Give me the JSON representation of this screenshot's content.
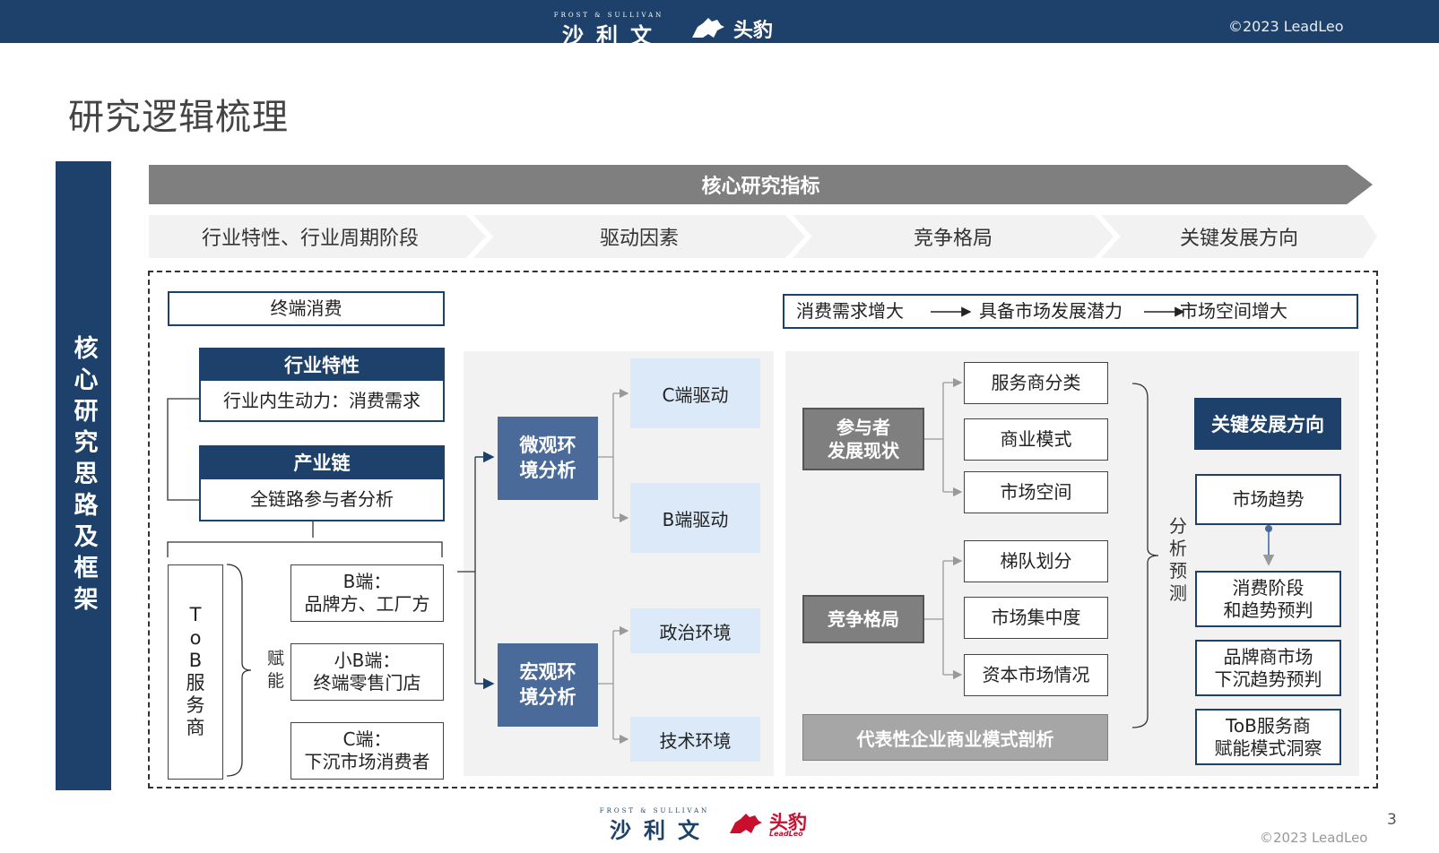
{
  "header": {
    "logo_small": "FROST & SULLIVAN",
    "logo_big": "沙利文",
    "logo_dog": "头豹",
    "logo_dog_sub": "LeadLeo",
    "copyright": "©2023 LeadLeo"
  },
  "title": "研究逻辑梳理",
  "side_label": "核心研究思路及框架",
  "core_indicator": "核心研究指标",
  "chevrons": [
    "行业特性、行业周期阶段",
    "驱动因素",
    "竞争格局",
    "关键发展方向"
  ],
  "col1": {
    "terminal": "终端消费",
    "industry_head": "行业特性",
    "industry_body": "行业内生动力：消费需求",
    "chain_head": "产业链",
    "chain_body": "全链路参与者分析",
    "tob_label": "ToB服务商",
    "empower": "赋能",
    "b_end_1": "B端：",
    "b_end_2": "品牌方、工厂方",
    "smallb_1": "小B端：",
    "smallb_2": "终端零售门店",
    "c_end_1": "C端：",
    "c_end_2": "下沉市场消费者"
  },
  "col2": {
    "micro_1": "微观环",
    "micro_2": "境分析",
    "c_drive": "C端驱动",
    "b_drive": "B端驱动",
    "macro_1": "宏观环",
    "macro_2": "境分析",
    "politics": "政治环境",
    "tech": "技术环境"
  },
  "flow": [
    "消费需求增大",
    "具备市场发展潜力",
    "市场空间增大"
  ],
  "col3": {
    "participants_1": "参与者",
    "participants_2": "发展现状",
    "sp_class": "服务商分类",
    "biz_model": "商业模式",
    "market_space": "市场空间",
    "competition": "竞争格局",
    "tier": "梯队划分",
    "concentration": "市场集中度",
    "capital": "资本市场情况",
    "representative": "代表性企业商业模式剖析"
  },
  "col4": {
    "analysis": "分析预测",
    "key_dir": "关键发展方向",
    "trend": "市场趋势",
    "stage_1": "消费阶段",
    "stage_2": "和趋势预判",
    "brand_1": "品牌商市场",
    "brand_2": "下沉趋势预判",
    "tob_1": "ToB服务商",
    "tob_2": "赋能模式洞察"
  },
  "footer": {
    "logo_small": "FROST & SULLIVAN",
    "logo_big": "沙利文",
    "logo_dog": "头豹",
    "logo_dog_sub": "LeadLeo",
    "copyright": "©2023 LeadLeo",
    "page_number": "3"
  },
  "colors": {
    "navy": "#1d416a",
    "mid_blue": "#4a6a9a",
    "light_blue": "#dbe9f8",
    "gray": "#7f7f7f",
    "light_gray": "#f2f2f2",
    "logo_red": "#c8102e"
  }
}
